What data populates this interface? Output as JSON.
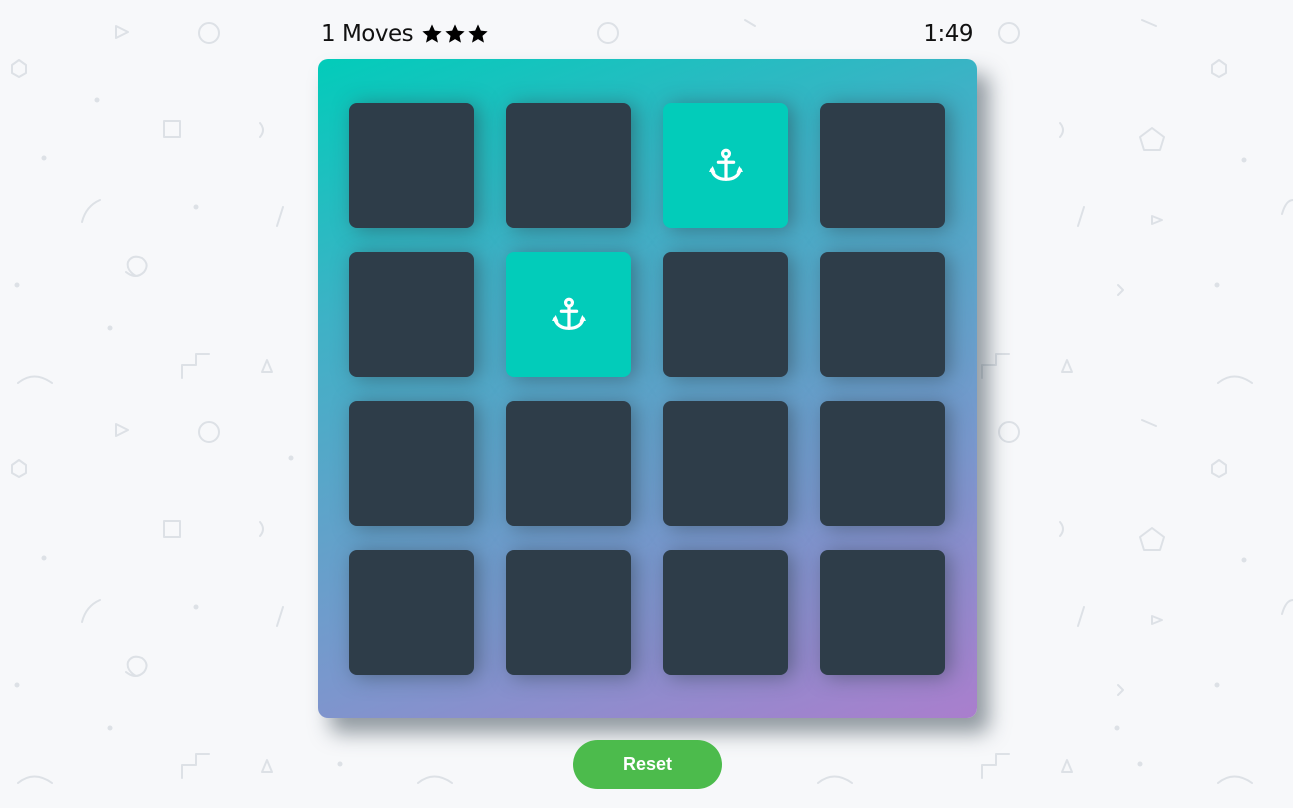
{
  "score_panel": {
    "moves_text": "1 Moves",
    "stars_count": 3,
    "timer": "1:49"
  },
  "deck": {
    "cards": [
      {
        "open": false,
        "icon": ""
      },
      {
        "open": false,
        "icon": ""
      },
      {
        "open": true,
        "icon": "anchor-icon"
      },
      {
        "open": false,
        "icon": ""
      },
      {
        "open": false,
        "icon": ""
      },
      {
        "open": true,
        "icon": "anchor-icon"
      },
      {
        "open": false,
        "icon": ""
      },
      {
        "open": false,
        "icon": ""
      },
      {
        "open": false,
        "icon": ""
      },
      {
        "open": false,
        "icon": ""
      },
      {
        "open": false,
        "icon": ""
      },
      {
        "open": false,
        "icon": ""
      },
      {
        "open": false,
        "icon": ""
      },
      {
        "open": false,
        "icon": ""
      },
      {
        "open": false,
        "icon": ""
      },
      {
        "open": false,
        "icon": ""
      }
    ]
  },
  "reset_label": "Reset",
  "colors": {
    "card_closed": "#2e3d49",
    "card_open": "#02ccba",
    "reset_button": "#4cbb4c"
  }
}
